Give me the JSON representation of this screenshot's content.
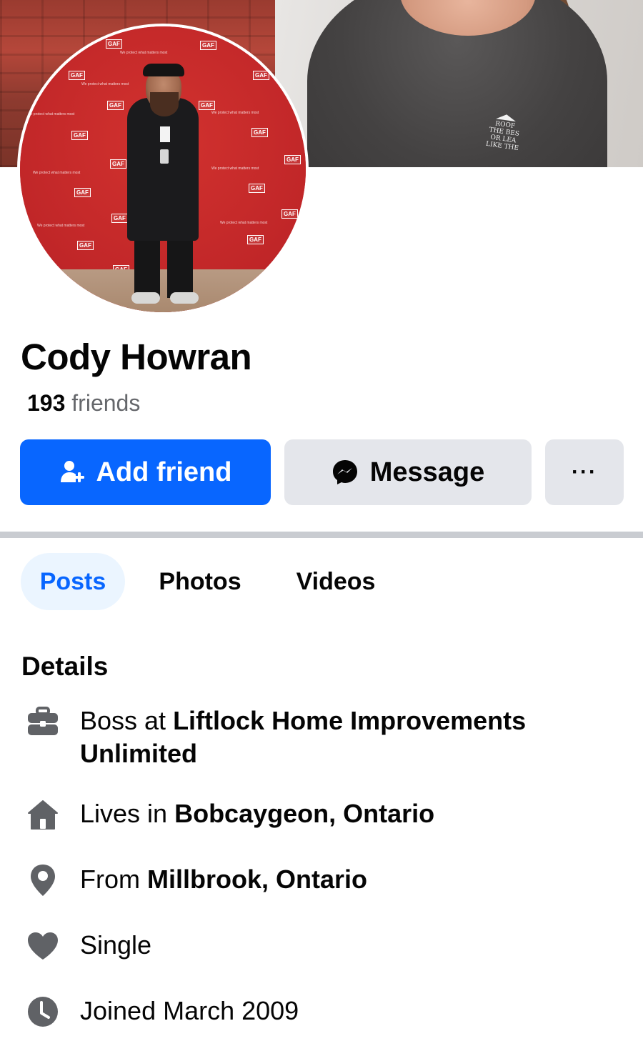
{
  "profile": {
    "name": "Cody Howran",
    "friends_count": "193",
    "friends_label": "friends"
  },
  "cover": {
    "logo_lines": [
      "ROOF",
      "THE BES",
      "OR LEA",
      "LIKE THE"
    ]
  },
  "avatar": {
    "backdrop_logo": "GAF",
    "backdrop_tagline": "We protect what matters most"
  },
  "actions": {
    "add_friend_label": "Add friend",
    "message_label": "Message",
    "more_label": "···",
    "primary_color": "#0866ff",
    "secondary_color": "#e4e6eb"
  },
  "tabs": [
    {
      "label": "Posts",
      "active": true
    },
    {
      "label": "Photos",
      "active": false
    },
    {
      "label": "Videos",
      "active": false
    }
  ],
  "details": {
    "title": "Details",
    "work": {
      "prefix": "Boss at ",
      "value": "Liftlock Home Improvements Unlimited",
      "icon": "briefcase-icon"
    },
    "lives": {
      "prefix": "Lives in ",
      "value": "Bobcaygeon, Ontario",
      "icon": "home-icon"
    },
    "from": {
      "prefix": "From ",
      "value": "Millbrook, Ontario",
      "icon": "location-pin-icon"
    },
    "relationship": {
      "value": "Single",
      "icon": "heart-icon"
    },
    "joined": {
      "value": "Joined March 2009",
      "icon": "clock-icon"
    }
  }
}
